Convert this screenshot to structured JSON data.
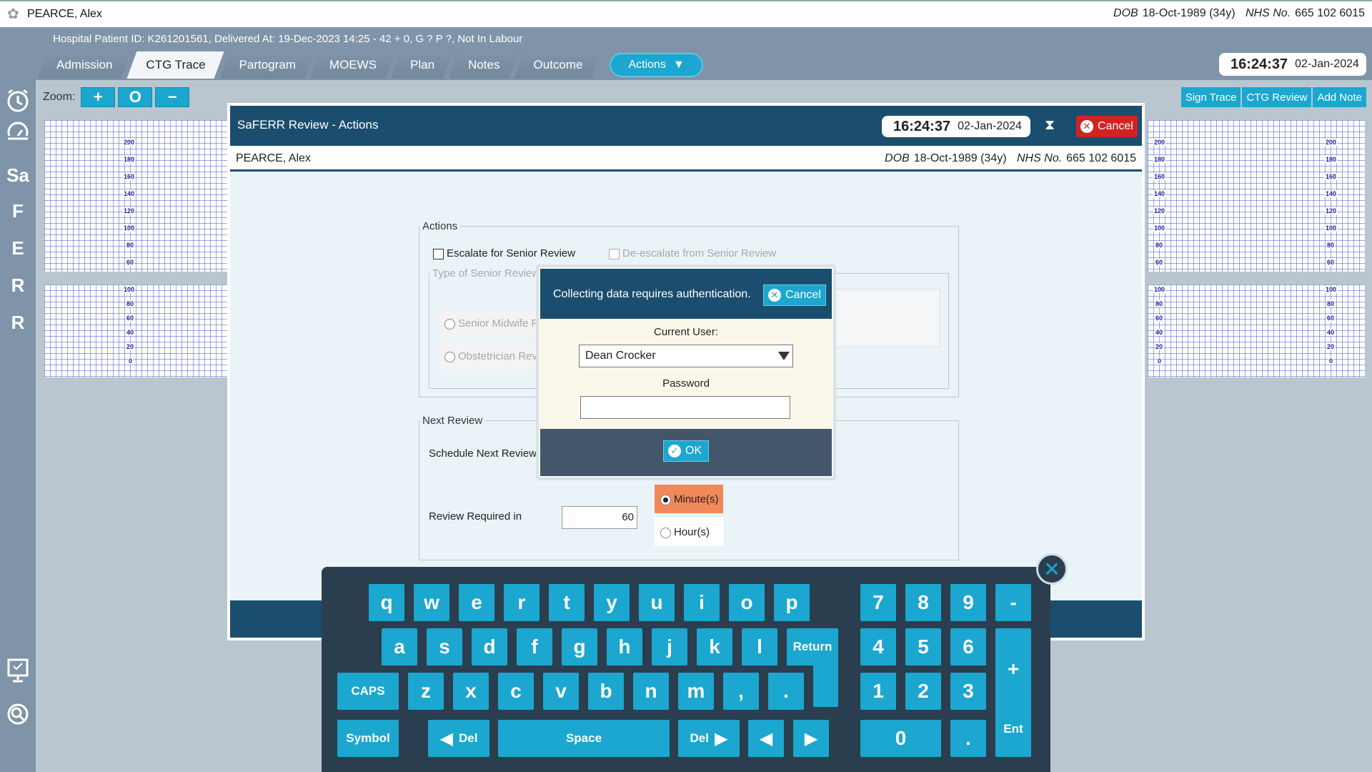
{
  "patient": {
    "name": "PEARCE, Alex",
    "dob_label": "DOB",
    "dob": "18-Oct-1989 (34y)",
    "nhs_label": "NHS No.",
    "nhs": "665 102 6015"
  },
  "header": {
    "hospital_info": "Hospital Patient ID: K261201561, Delivered At: 19-Dec-2023 14:25 - 42 + 0, G ? P ?,   Not In Labour",
    "tabs": [
      "Admission",
      "CTG Trace",
      "Partogram",
      "MOEWS",
      "Plan",
      "Notes",
      "Outcome"
    ],
    "actions_label": "Actions",
    "time": "16:24:37",
    "date": "02-Jan-2024"
  },
  "sidebar": {
    "letters": [
      "Sa",
      "F",
      "E",
      "R",
      "R"
    ]
  },
  "workspace": {
    "zoom_label": "Zoom:",
    "zoom_buttons": [
      "+",
      "O",
      "−"
    ],
    "right_buttons": [
      "Sign Trace",
      "CTG Review",
      "Add Note"
    ],
    "fhr_scale": [
      "200",
      "180",
      "160",
      "140",
      "120",
      "100",
      "80",
      "60"
    ],
    "toco_scale": [
      "100",
      "80",
      "60",
      "40",
      "20",
      "0"
    ]
  },
  "modal": {
    "title": "SaFERR Review - Actions",
    "time": "16:24:37",
    "date": "02-Jan-2024",
    "cancel_label": "Cancel",
    "actions_legend": "Actions",
    "escalate_label": "Escalate for Senior Review",
    "deescalate_label": "De-escalate from Senior Review",
    "type_legend": "Type of Senior Review",
    "senior_midwife": "Senior Midwife R",
    "obstetrician": "Obstetrician Revi",
    "next_review_legend": "Next Review",
    "schedule_label": "Schedule Next Review",
    "review_required_label": "Review Required in",
    "review_value": "60",
    "minutes_label": "Minute(s)",
    "hours_label": "Hour(s)"
  },
  "auth": {
    "message": "Collecting data requires authentication.",
    "cancel_label": "Cancel",
    "current_user_label": "Current User:",
    "current_user": "Dean Crocker",
    "password_label": "Password",
    "ok_label": "OK"
  },
  "keyboard": {
    "row1": [
      "q",
      "w",
      "e",
      "r",
      "t",
      "y",
      "u",
      "i",
      "o",
      "p"
    ],
    "row2": [
      "a",
      "s",
      "d",
      "f",
      "g",
      "h",
      "j",
      "k",
      "l"
    ],
    "row3": [
      "z",
      "x",
      "c",
      "v",
      "b",
      "n",
      "m",
      ",",
      "."
    ],
    "caps": "CAPS",
    "return": "Return",
    "symbol": "Symbol",
    "del_left": "Del",
    "space": "Space",
    "del_right": "Del",
    "num_row1": [
      "7",
      "8",
      "9",
      "-"
    ],
    "num_row2": [
      "4",
      "5",
      "6"
    ],
    "num_row3": [
      "1",
      "2",
      "3"
    ],
    "zero": "0",
    "dot": ".",
    "plus": "+",
    "ent": "Ent"
  }
}
